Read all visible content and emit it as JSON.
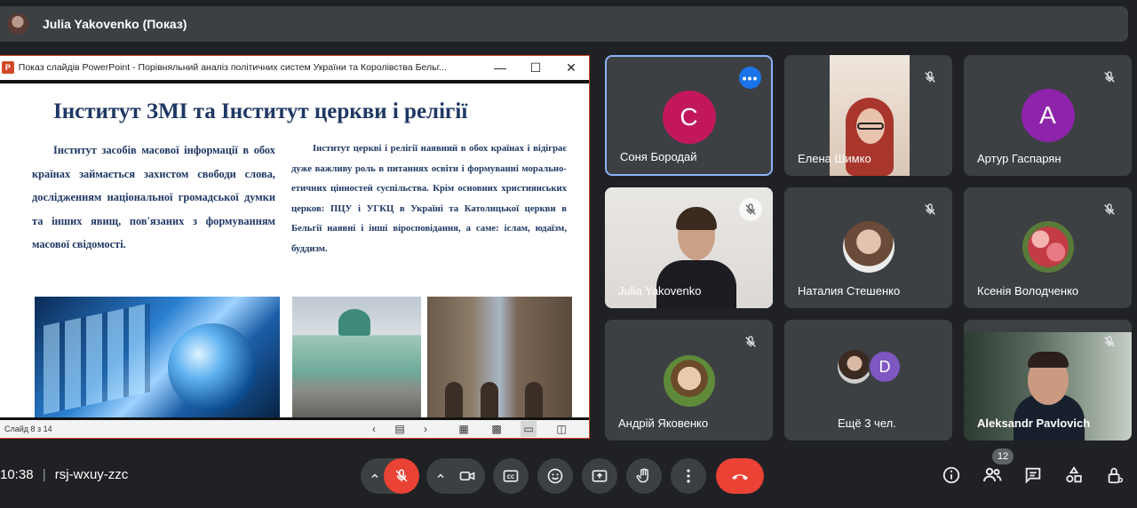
{
  "presenter": {
    "name": "Julia Yakovenko (Показ)"
  },
  "ppt": {
    "window_title": "Показ слайдів PowerPoint  -  Порівняльний аналіз політичних систем України та Королівства Бельг...",
    "slide": {
      "title": "Інститут ЗМІ та Інститут церкви і релігії",
      "left_text": "Інститут засобів масової інформації в обох країнах займається захистом свободи слова, дослідженням національної громадської думки та інших явищ, пов'язаних з формуванням масової свідомості.",
      "right_text": "Інститут церкві і релігії наявний в обох країнах і відіграє дуже важливу роль в питаннях освіти і формуванні морально-етичних цінностей суспільства. Крім основних християнських церков: ПЦУ і УГКЦ в Україні та Католицької церкви в Бельгії наявні і інші віросповідання, а саме: іслам, юдаїзм, буддизм."
    },
    "status": "Слайд 8 з 14"
  },
  "participants": [
    {
      "name": "Соня Бородай",
      "letter": "С",
      "color": "#c2185b"
    },
    {
      "name": "Елена Шимко"
    },
    {
      "name": "Артур Гаспарян",
      "letter": "А",
      "color": "#8e24aa"
    },
    {
      "name": "Julia Yakovenko"
    },
    {
      "name": "Наталия Стешенко"
    },
    {
      "name": "Ксенія Володченко"
    },
    {
      "name": "Андрій Яковенко"
    },
    {
      "name": "Ещё 3 чел.",
      "letter": "D",
      "color": "#7e57c2"
    },
    {
      "name": "Aleksandr Pavlovich"
    }
  ],
  "meeting": {
    "time": "10:38",
    "separator": "|",
    "code": "rsj-wxuy-zzc"
  },
  "people_count": "12",
  "icons": [
    "mic-off-icon",
    "camera-icon",
    "captions-icon",
    "emoji-icon",
    "present-icon",
    "raise-hand-icon",
    "more-vert-icon",
    "end-call-icon",
    "info-icon",
    "people-icon",
    "chat-icon",
    "activities-icon",
    "host-controls-icon"
  ],
  "colors": {
    "end_call": "#ea4335",
    "active_border": "#8ab4f8",
    "ppt_accent": "#d24726"
  }
}
